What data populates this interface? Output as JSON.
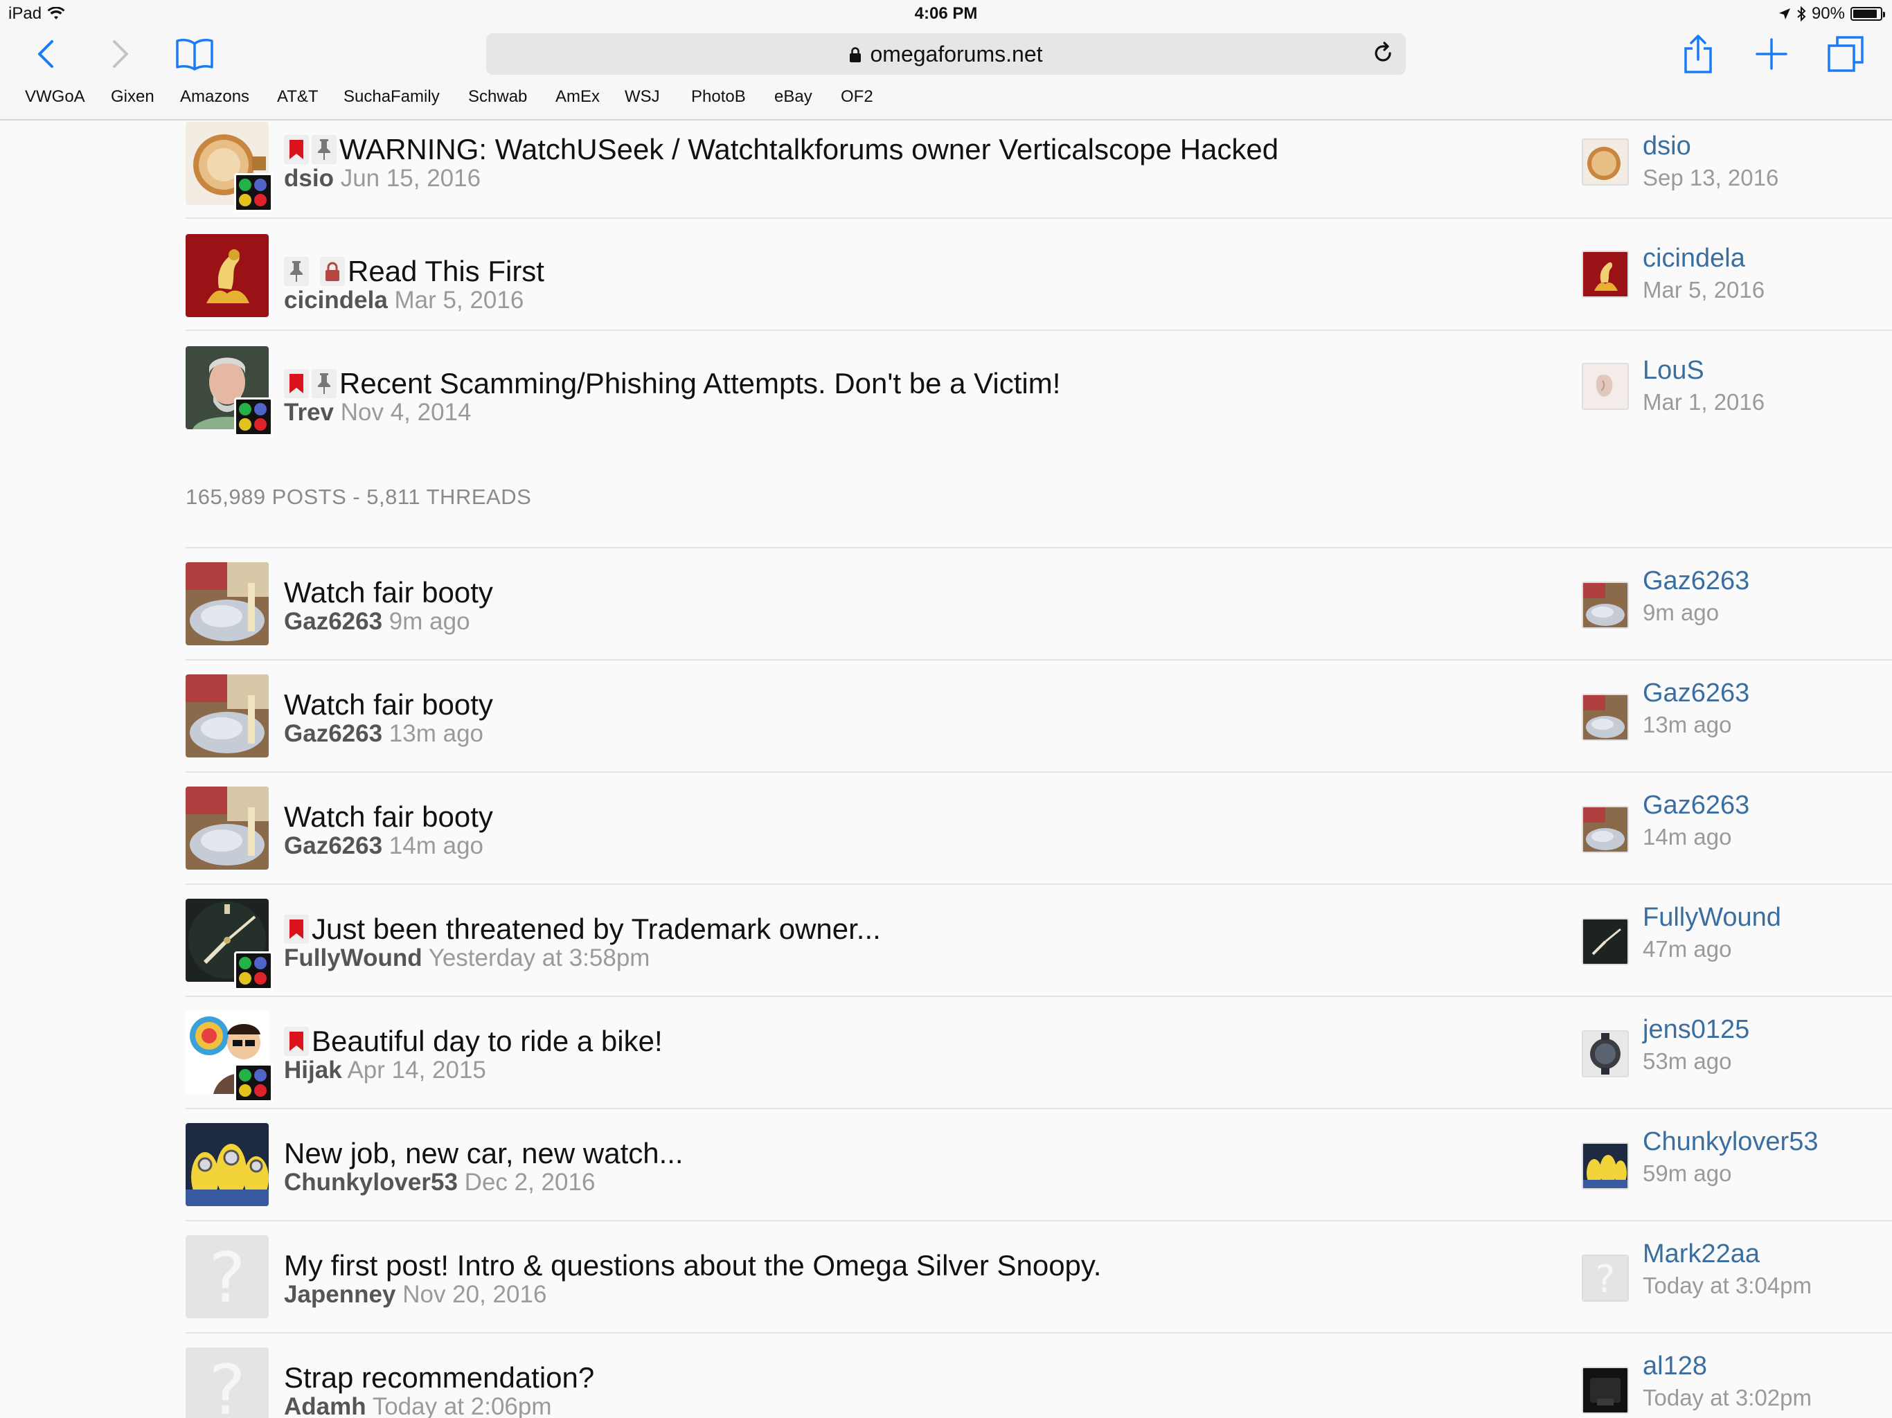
{
  "status_bar": {
    "device": "iPad",
    "time": "4:06 PM",
    "battery": "90%",
    "battery_level": 0.9
  },
  "browser": {
    "url_host": "omegaforums.net",
    "bookmarks": [
      "VWGoA",
      "Gixen",
      "Amazons",
      "AT&T",
      "SuchaFamily",
      "Schwab",
      "AmEx",
      "WSJ",
      "PhotoB",
      "eBay",
      "OF2"
    ]
  },
  "sticky_threads": [
    {
      "title": "WARNING: WatchUSeek / Watchtalkforums owner Verticalscope Hacked",
      "author": "dsio",
      "date": "Jun 15, 2016",
      "last_user": "dsio",
      "last_date": "Sep 13, 2016",
      "icons": [
        "bookmark-icon",
        "pin-icon"
      ]
    },
    {
      "title": "Read This First",
      "author": "cicindela",
      "date": "Mar 5, 2016",
      "last_user": "cicindela",
      "last_date": "Mar 5, 2016",
      "icons": [
        "pin-icon",
        "lock-icon"
      ]
    },
    {
      "title": "Recent Scamming/Phishing Attempts. Don't be a Victim!",
      "author": "Trev",
      "date": "Nov 4, 2014",
      "last_user": "LouS",
      "last_date": "Mar 1, 2016",
      "icons": [
        "bookmark-icon",
        "pin-icon"
      ]
    }
  ],
  "stats": "165,989 POSTS - 5,811 THREADS",
  "threads": [
    {
      "title": "Watch fair booty",
      "author": "Gaz6263",
      "date": "9m ago",
      "last_user": "Gaz6263",
      "last_date": "9m ago"
    },
    {
      "title": "Watch fair booty",
      "author": "Gaz6263",
      "date": "13m ago",
      "last_user": "Gaz6263",
      "last_date": "13m ago"
    },
    {
      "title": "Watch fair booty",
      "author": "Gaz6263",
      "date": "14m ago",
      "last_user": "Gaz6263",
      "last_date": "14m ago"
    },
    {
      "title": "Just been threatened by Trademark owner...",
      "author": "FullyWound",
      "date": "Yesterday at 3:58pm",
      "last_user": "FullyWound",
      "last_date": "47m ago",
      "icons": [
        "bookmark-icon"
      ]
    },
    {
      "title": "Beautiful day to ride a bike!",
      "author": "Hijak",
      "date": "Apr 14, 2015",
      "last_user": "jens0125",
      "last_date": "53m ago",
      "icons": [
        "bookmark-icon"
      ]
    },
    {
      "title": "New job, new car, new watch...",
      "author": "Chunkylover53",
      "date": "Dec 2, 2016",
      "last_user": "Chunkylover53",
      "last_date": "59m ago"
    },
    {
      "title": "My first post! Intro & questions about the Omega Silver Snoopy.",
      "author": "Japenney",
      "date": "Nov 20, 2016",
      "last_user": "Mark22aa",
      "last_date": "Today at 3:04pm"
    },
    {
      "title": "Strap recommendation?",
      "author": "Adamh",
      "date": "Today at 2:06pm",
      "last_user": "al128",
      "last_date": "Today at 3:02pm"
    }
  ],
  "colors": {
    "link": "#3b6ea0",
    "accent": "#1a7cf5",
    "bookmark_red": "#d9121b"
  }
}
